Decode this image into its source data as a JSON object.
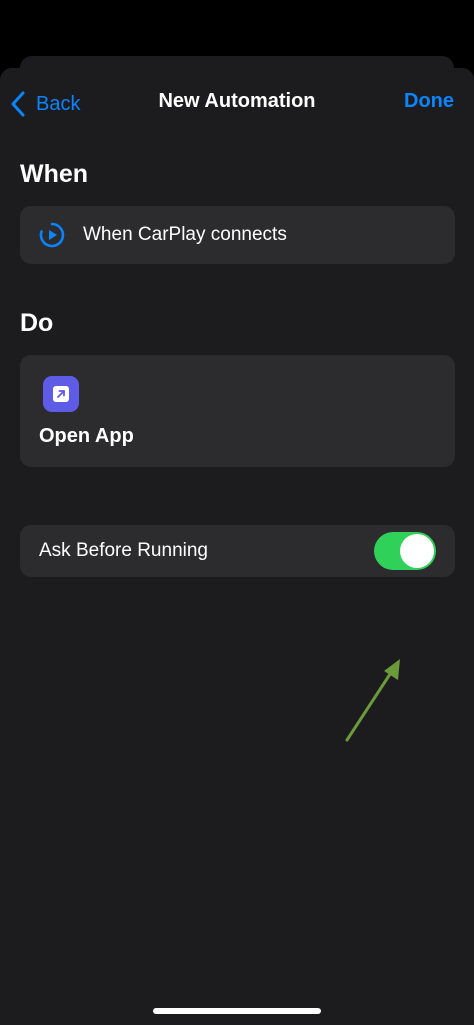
{
  "nav": {
    "back_label": "Back",
    "title": "New Automation",
    "done_label": "Done"
  },
  "when_section": {
    "heading": "When",
    "trigger": {
      "label": "When CarPlay connects",
      "icon": "carplay-play-icon"
    }
  },
  "do_section": {
    "heading": "Do",
    "action": {
      "label": "Open App",
      "icon": "open-app-icon"
    }
  },
  "ask_before_running": {
    "label": "Ask Before Running",
    "enabled": true
  },
  "colors": {
    "accent": "#0a84ff",
    "toggle_on": "#30d158",
    "app_icon": "#5e5ce6",
    "annotation_arrow": "#6a9a3a",
    "card_background": "#2c2c2e",
    "sheet_background": "#1c1c1e"
  }
}
